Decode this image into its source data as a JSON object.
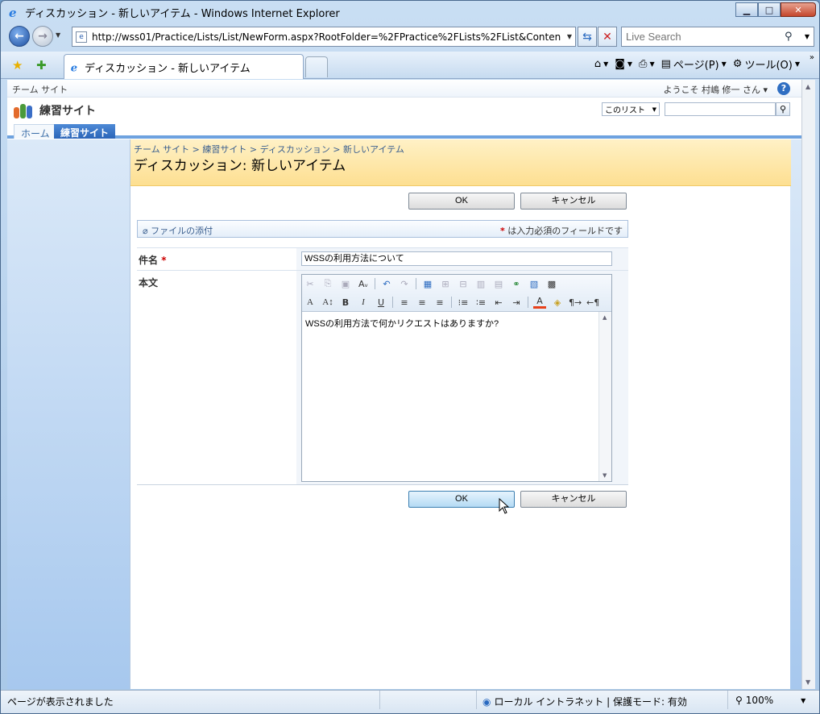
{
  "window": {
    "title": "ディスカッション - 新しいアイテム - Windows Internet Explorer",
    "minimize": "▁",
    "maximize": "□",
    "close": "✕"
  },
  "address": {
    "url": "http://wss01/Practice/Lists/List/NewForm.aspx?RootFolder=%2FPractice%2FLists%2FList&Conten",
    "search_placeholder": "Live Search"
  },
  "tabs": {
    "active_label": "ディスカッション - 新しいアイテム"
  },
  "toolbar": {
    "page_label": "ページ(P)",
    "tools_label": "ツール(O)"
  },
  "sharepoint": {
    "top_crumb": "チーム サイト",
    "welcome": "ようこそ 村嶋 修一 さん ▾",
    "site_name": "練習サイト",
    "scope_select": "このリスト",
    "nav": {
      "home": "ホーム",
      "current": "練習サイト"
    },
    "breadcrumb": "チーム サイト > 練習サイト > ディスカッション > 新しいアイテム",
    "page_title": "ディスカッション: 新しいアイテム"
  },
  "form": {
    "ok_label": "OK",
    "cancel_label": "キャンセル",
    "attach_label": "ファイルの添付",
    "required_note": "は入力必須のフィールドです",
    "required_mark": "*",
    "subject_label": "件名",
    "subject_value": "WSSの利用方法について",
    "body_label": "本文",
    "body_value": "WSSの利用方法で何かリクエストはありますか?"
  },
  "status": {
    "message": "ページが表示されました",
    "zone": "ローカル イントラネット | 保護モード: 有効",
    "zoom": "100%"
  },
  "colors": {
    "accent": "#2a64b8",
    "banner": "#fddf91",
    "required": "#cc0000"
  }
}
